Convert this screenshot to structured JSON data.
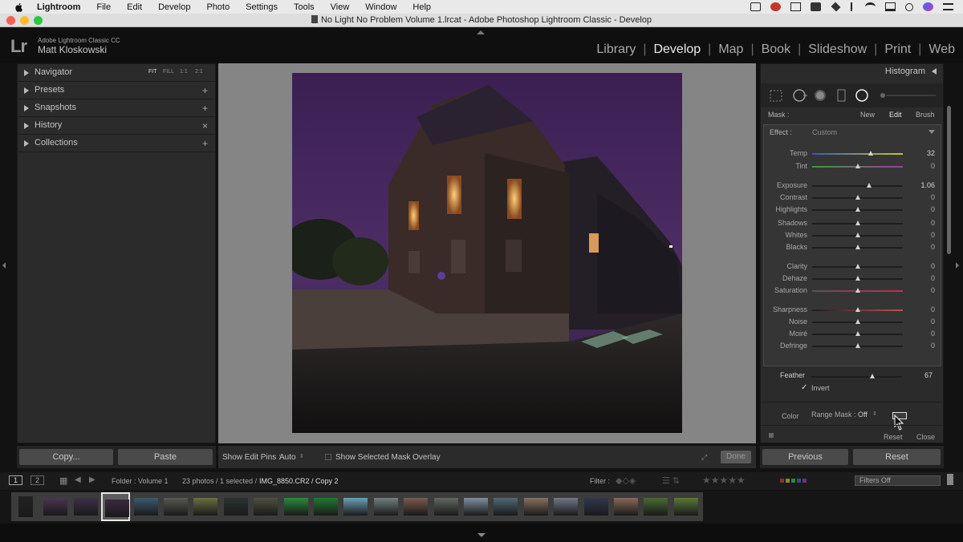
{
  "menubar": {
    "app": "Lightroom",
    "items": [
      "File",
      "Edit",
      "Develop",
      "Photo",
      "Settings",
      "Tools",
      "View",
      "Window",
      "Help"
    ]
  },
  "window": {
    "title": "No Light No Problem Volume 1.lrcat - Adobe Photoshop Lightroom Classic - Develop"
  },
  "identity": {
    "logo": "Lr",
    "app_name": "Adobe Lightroom Classic CC",
    "user": "Matt Kloskowski"
  },
  "modules": {
    "items": [
      "Library",
      "Develop",
      "Map",
      "Book",
      "Slideshow",
      "Print",
      "Web"
    ],
    "active": "Develop"
  },
  "left_panel": {
    "navigator": {
      "label": "Navigator",
      "zoom": [
        "FIT",
        "FILL",
        "1:1",
        "2:1"
      ]
    },
    "presets": {
      "label": "Presets",
      "action": "+"
    },
    "snapshots": {
      "label": "Snapshots",
      "action": "+"
    },
    "history": {
      "label": "History",
      "action": "×"
    },
    "collections": {
      "label": "Collections",
      "action": "+"
    },
    "copy_label": "Copy...",
    "paste_label": "Paste"
  },
  "toolbar": {
    "show_pins_label": "Show Edit Pins :",
    "show_pins_value": "Auto",
    "overlay_label": "Show Selected Mask Overlay",
    "done_label": "Done"
  },
  "right_panel": {
    "histogram_label": "Histogram",
    "mask_label": "Mask :",
    "mask_new": "New",
    "mask_edit": "Edit",
    "mask_brush": "Brush",
    "effect_label": "Effect :",
    "effect_value": "Custom",
    "sliders": [
      {
        "name": "Temp",
        "value": "32",
        "pos": 0.65
      },
      {
        "name": "Tint",
        "value": "0",
        "pos": 0.5
      },
      {
        "name": "Exposure",
        "value": "1.06",
        "pos": 0.63
      },
      {
        "name": "Contrast",
        "value": "0",
        "pos": 0.5
      },
      {
        "name": "Highlights",
        "value": "0",
        "pos": 0.5
      },
      {
        "name": "Shadows",
        "value": "0",
        "pos": 0.5
      },
      {
        "name": "Whites",
        "value": "0",
        "pos": 0.5
      },
      {
        "name": "Blacks",
        "value": "0",
        "pos": 0.5
      },
      {
        "name": "Clarity",
        "value": "0",
        "pos": 0.5
      },
      {
        "name": "Dehaze",
        "value": "0",
        "pos": 0.5
      },
      {
        "name": "Saturation",
        "value": "0",
        "pos": 0.5
      },
      {
        "name": "Sharpness",
        "value": "0",
        "pos": 0.5
      },
      {
        "name": "Noise",
        "value": "0",
        "pos": 0.5
      },
      {
        "name": "Moiré",
        "value": "0",
        "pos": 0.5
      },
      {
        "name": "Defringe",
        "value": "0",
        "pos": 0.5
      }
    ],
    "color_label": "Color",
    "feather_label": "Feather",
    "feather_value": "67",
    "feather_pos": 0.67,
    "invert_label": "Invert",
    "range_mask_label": "Range Mask :",
    "range_mask_value": "Off",
    "reset_label": "Reset",
    "close_label": "Close",
    "previous_label": "Previous",
    "reset_button_label": "Reset"
  },
  "filmstrip": {
    "view1": "1",
    "view2": "2",
    "folder": "Folder : Volume 1",
    "count": "23 photos / 1 selected /",
    "file": "IMG_8850.CR2 / Copy 2",
    "filter_label": "Filter :",
    "filters_off": "Filters Off",
    "thumbnails": 23,
    "selected_index": 3
  },
  "colors": {
    "accent": "#e8e8e8",
    "panel": "#2b2b2b",
    "background": "#121212"
  }
}
